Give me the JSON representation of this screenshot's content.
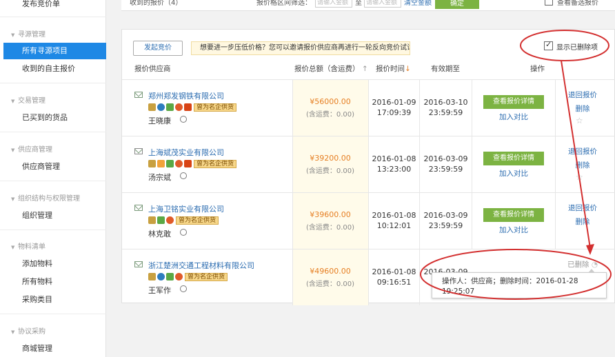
{
  "sidebar": {
    "top_item": "发布竞价单",
    "groups": [
      {
        "title": "寻源管理",
        "items": [
          "所有寻源项目",
          "收到的自主报价"
        ]
      },
      {
        "title": "交易管理",
        "items": [
          "已买到的货品"
        ]
      },
      {
        "title": "供应商管理",
        "items": [
          "供应商管理"
        ]
      },
      {
        "title": "组织结构与权限管理",
        "items": [
          "组织管理"
        ]
      },
      {
        "title": "物料清单",
        "items": [
          "添加物料",
          "所有物料",
          "采购类目"
        ]
      },
      {
        "title": "协议采购",
        "items": [
          "商城管理"
        ]
      }
    ],
    "active_item": "所有寻源项目"
  },
  "topbar": {
    "received_quotes": "收到的报价（4）",
    "price_filter_label": "报价格区间筛选：",
    "min_placeholder": "请输入金额",
    "to": "至",
    "max_placeholder": "请输入金额",
    "clear": "清空金额",
    "confirm": "确定",
    "view_selected": "查看备选报价"
  },
  "toolbar": {
    "initiate_button": "发起竞价",
    "tip": "想要进一步压低价格？您可以邀请报价供应商再进行一轮反向竞价试试哦",
    "show_deleted": "显示已删除项"
  },
  "table": {
    "headers": {
      "supplier": "报价供应商",
      "total": "报价总额（含运费）",
      "sort_up": "↑",
      "time": "报价时间",
      "sort_down": "↓",
      "valid": "有效期至",
      "ops": "操作"
    },
    "famous_label": "曾为名企供货",
    "freight_label": "(含运费：0.00)",
    "detail_button": "查看报价详情",
    "add_compare": "加入对比",
    "withdraw": "退回报价",
    "delete": "删除",
    "deleted_label": "已删除",
    "rows": [
      {
        "supplier": "郑州郑发钢铁有限公司",
        "contact": "王晓康",
        "price": "¥56000.00",
        "time_date": "2016-01-09",
        "time_clock": "17:09:39",
        "valid_date": "2016-03-10",
        "valid_clock": "23:59:59"
      },
      {
        "supplier": "上海斌茂实业有限公司",
        "contact": "汤宗斌",
        "price": "¥39200.00",
        "time_date": "2016-01-08",
        "time_clock": "13:23:00",
        "valid_date": "2016-03-09",
        "valid_clock": "23:59:59"
      },
      {
        "supplier": "上海卫铭实业有限公司",
        "contact": "林克敢",
        "price": "¥39600.00",
        "time_date": "2016-01-08",
        "time_clock": "10:12:01",
        "valid_date": "2016-03-09",
        "valid_clock": "23:59:59"
      },
      {
        "supplier": "浙江楚洲交通工程材料有限公司",
        "contact": "王军作",
        "price": "¥49600.00",
        "time_date": "2016-01-08",
        "time_clock": "09:16:51",
        "valid_date": "2016-03-09",
        "valid_clock": ""
      }
    ],
    "tooltip_line1": "操作人：供应商；删除时间：2016-01-28",
    "tooltip_line2": "19:25:07"
  },
  "colors": {
    "accent_blue": "#1e88e5",
    "button_green": "#7cb342",
    "price_orange": "#e67e22",
    "annotation_red": "#d32f2f"
  }
}
